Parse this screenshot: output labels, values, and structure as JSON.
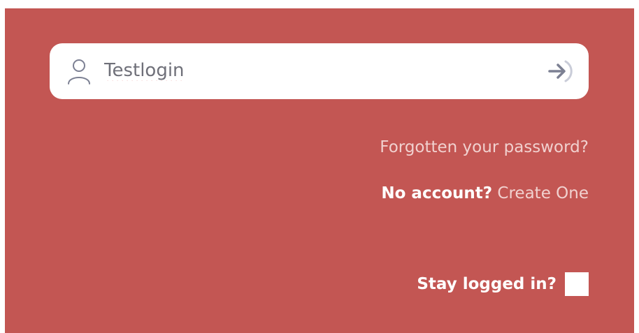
{
  "login": {
    "username_value": "Testlogin",
    "username_icon": "user-icon",
    "submit_icon": "arrow-right-login-icon"
  },
  "links": {
    "forgot_password": "Forgotten your password?",
    "no_account_label": "No account?",
    "create_one": "Create One"
  },
  "stay_logged_in": {
    "label": "Stay logged in?",
    "checked": false
  },
  "colors": {
    "panel_background": "#c35653",
    "input_background": "#ffffff",
    "link_text": "#f1d1cf",
    "label_text": "#ffffff",
    "icon": "#7c8093"
  }
}
